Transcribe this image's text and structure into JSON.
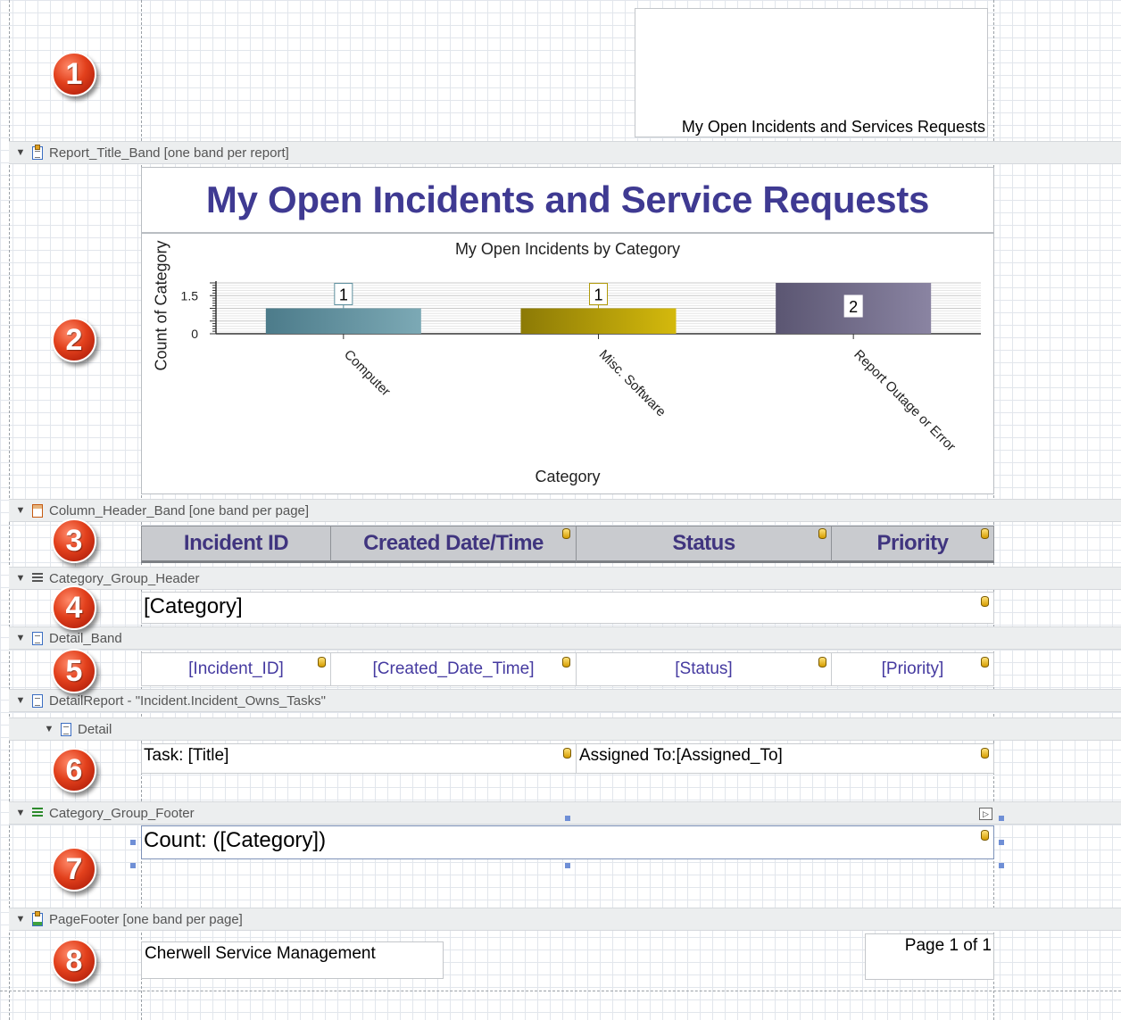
{
  "markers": [
    "1",
    "2",
    "3",
    "4",
    "5",
    "6",
    "7",
    "8"
  ],
  "bands": {
    "report_title": "Report_Title_Band [one band per report]",
    "column_header": "Column_Header_Band [one band per page]",
    "group_header": "Category_Group_Header",
    "detail": "Detail_Band",
    "detail_report": "DetailReport - \"Incident.Incident_Owns_Tasks\"",
    "detail_sub": "Detail",
    "group_footer": "Category_Group_Footer",
    "page_footer": "PageFooter [one band per page]"
  },
  "page_header_label": "My Open Incidents and Services Requests",
  "report_title": "My Open Incidents and Service Requests",
  "chart_data": {
    "type": "bar",
    "title": "My Open Incidents by Category",
    "xlabel": "Category",
    "ylabel": "Count of Category",
    "categories": [
      "Computer",
      "Misc. Software",
      "Report Outage or Error"
    ],
    "values": [
      1,
      1,
      2
    ],
    "y_tick_labels": [
      "0",
      "1.5"
    ],
    "ylim": [
      0,
      2
    ],
    "colors": [
      "#5d8f9e",
      "#b09a0a",
      "#6c6783"
    ]
  },
  "column_headers": [
    "Incident ID",
    "Created Date/Time",
    "Status",
    "Priority"
  ],
  "group_header_field": "[Category]",
  "detail_fields": [
    "[Incident_ID]",
    "[Created_Date_Time]",
    "[Status]",
    "[Priority]"
  ],
  "task_title": "Task: [Title]",
  "task_assigned": "Assigned To:[Assigned_To]",
  "group_footer_count": "Count: ([Category])",
  "footer_company": "Cherwell Service Management",
  "footer_page": "Page 1 of 1",
  "colors": {
    "title_purple": "#3f3a92",
    "field_purple": "#453aa0",
    "marker_red": "#e2401c"
  }
}
